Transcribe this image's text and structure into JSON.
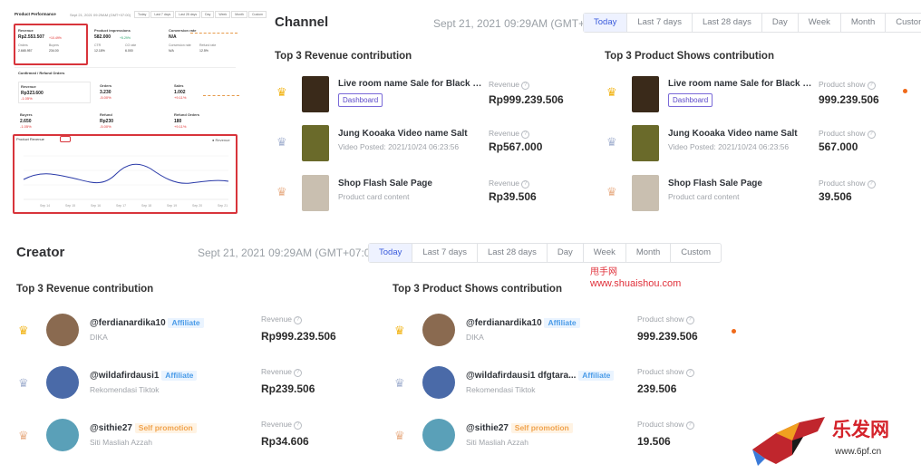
{
  "product_performance": {
    "title": "Product Performance",
    "date": "Sept 21, 2021 09:29AM (GMT+07:00)",
    "tabs": [
      "Today",
      "Last 7 days",
      "Last 28 days",
      "Day",
      "Week",
      "Month",
      "Custom"
    ],
    "metrics_top": [
      {
        "label": "Revenue",
        "value": "Rp2.553.507",
        "change": "+10.49%",
        "sub1_label": "Orders",
        "sub1_value": "2.665.957",
        "sub2_label": "Buyers",
        "sub2_value": "234.00"
      },
      {
        "label": "Product impressions",
        "value": "582.000",
        "change": "+5.29%",
        "sub1_label": "CTR",
        "sub1_value": "12.18%",
        "sub2_label": "CO rate",
        "sub2_value": "6.000"
      },
      {
        "label": "Conversion rate",
        "value": "N/A",
        "change": "",
        "sub1_label": "Conversion rate",
        "sub1_value": "N/A",
        "sub2_label": "Refund rate",
        "sub2_value": "12.5%"
      }
    ],
    "funnel_title": "Confirmed / Refund Orders",
    "metrics_mid": [
      {
        "label": "Revenue",
        "value": "Rp323.600",
        "change": "-1.05%"
      },
      {
        "label": "Orders",
        "value": "3.230",
        "change": "-5.00%"
      },
      {
        "label": "Sales",
        "value": "1.002",
        "change": "+9.11%"
      }
    ],
    "metrics_bottom": [
      {
        "label": "Buyers",
        "value": "2.650",
        "change": "-1.05%"
      },
      {
        "label": "Refund",
        "value": "Rp230",
        "change": "-5.00%"
      },
      {
        "label": "Refund Orders",
        "value": "180",
        "change": "+9.11%"
      }
    ],
    "chart_selector": "Product Revenue",
    "chart_legend": "Revenue",
    "chart_ticks": [
      "Sep 14",
      "Sep 15",
      "Sep 16",
      "Sep 17",
      "Sep 18",
      "Sep 19",
      "Sep 20",
      "Sep 21"
    ]
  },
  "channel": {
    "title": "Channel",
    "date": "Sept 21, 2021 09:29AM (GMT+07:00)",
    "tabs": [
      "Today",
      "Last 7 days",
      "Last 28 days",
      "Day",
      "Week",
      "Month",
      "Custom"
    ],
    "revenue_title": "Top 3 Revenue contribution",
    "shows_title": "Top 3 Product Shows contribution",
    "revenue_label": "Revenue",
    "shows_label": "Product show",
    "badge": "Dashboard",
    "items": [
      {
        "name": "Live room name Sale for Black dli...",
        "sub": "",
        "revenue": "Rp999.239.506",
        "shows": "999.239.506",
        "thumb_color": "#3a2a1a"
      },
      {
        "name": "Jung Kooaka Video name Salt",
        "sub": "Video Posted: 2021/10/24 06:23:56",
        "revenue": "Rp567.000",
        "shows": "567.000",
        "thumb_color": "#6a6a2a"
      },
      {
        "name": "Shop Flash Sale Page",
        "sub": "Product card content",
        "revenue": "Rp39.506",
        "shows": "39.506",
        "thumb_color": "#c9bfb0"
      }
    ]
  },
  "creator": {
    "title": "Creator",
    "date": "Sept 21, 2021 09:29AM (GMT+07:00)",
    "tabs": [
      "Today",
      "Last 7 days",
      "Last 28 days",
      "Day",
      "Week",
      "Month",
      "Custom"
    ],
    "revenue_title": "Top 3 Revenue contribution",
    "shows_title": "Top 3 Product Shows contribution",
    "revenue_label": "Revenue",
    "shows_label": "Product show",
    "rev_items": [
      {
        "name": "@ferdianardika10",
        "tag": "Affiliate",
        "sub": "DIKA",
        "value": "Rp999.239.506"
      },
      {
        "name": "@wildafirdausi1",
        "tag": "Affiliate",
        "sub": "Rekomendasi Tiktok",
        "value": "Rp239.506"
      },
      {
        "name": "@sithie27",
        "tag": "Self promotion",
        "sub": "Siti Masliah Azzah",
        "value": "Rp34.606"
      }
    ],
    "show_items": [
      {
        "name": "@ferdianardika10",
        "tag": "Affiliate",
        "sub": "DIKA",
        "value": "999.239.506"
      },
      {
        "name": "@wildafirdausi1 dfgtara...",
        "tag": "Affiliate",
        "sub": "Rekomendasi Tiktok",
        "value": "239.506"
      },
      {
        "name": "@sithie27",
        "tag": "Self promotion",
        "sub": "Siti Masliah Azzah",
        "value": "19.506"
      }
    ]
  },
  "watermark": {
    "brand_cn": "甩手网",
    "url": "www.shuaishou.com",
    "logo_cn": "乐发网",
    "logo_url": "www.6pf.cn"
  },
  "colors": {
    "accent": "#3a5bdc",
    "highlight": "#d8343b",
    "affiliate": "#4a9be8",
    "self_promotion": "#f0a34e"
  }
}
